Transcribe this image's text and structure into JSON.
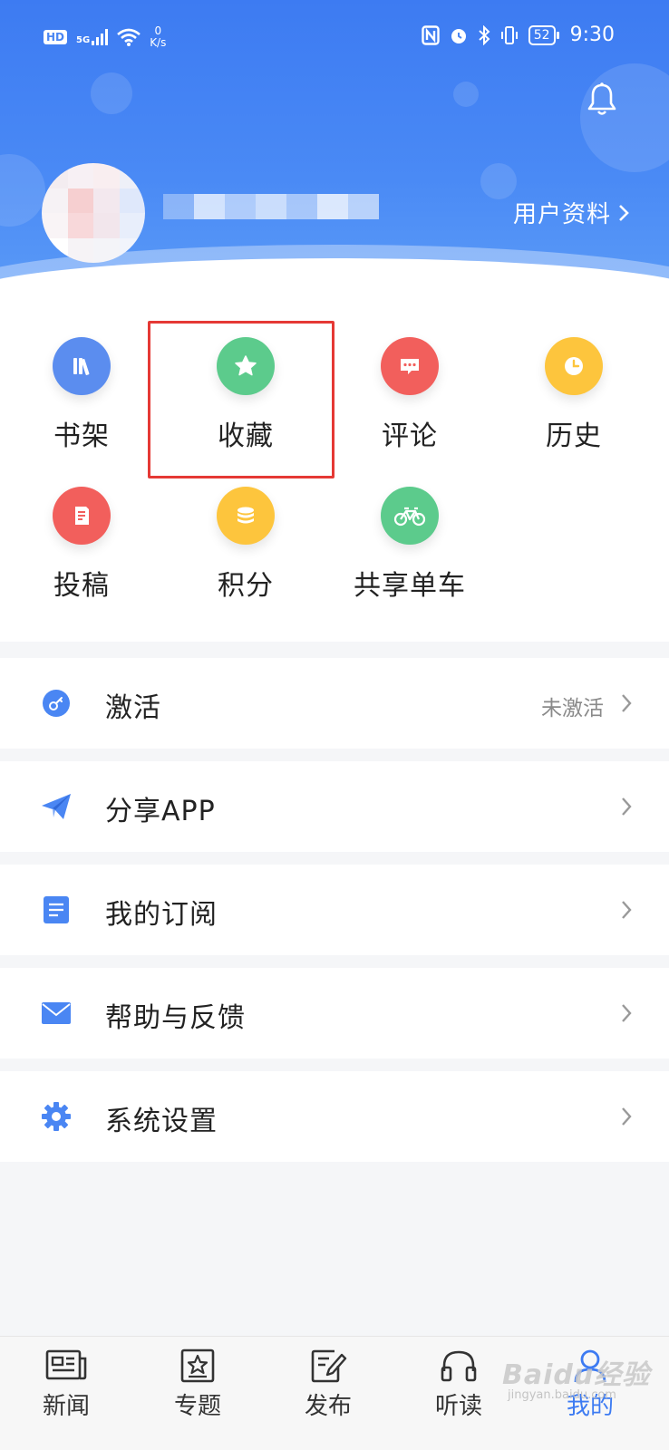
{
  "status_bar": {
    "hd": "HD",
    "network": "5G",
    "speed_value": "0",
    "speed_unit": "K/s",
    "battery": "52",
    "time": "9:30"
  },
  "profile": {
    "link_label": "用户资料",
    "link_icon": "chevron-right-icon"
  },
  "grid": [
    {
      "label": "书架",
      "icon": "bookshelf-icon",
      "color": "#5b8def"
    },
    {
      "label": "收藏",
      "icon": "star-icon",
      "color": "#5ccb8c"
    },
    {
      "label": "评论",
      "icon": "comment-icon",
      "color": "#f25f5c"
    },
    {
      "label": "历史",
      "icon": "clock-icon",
      "color": "#fdc53d"
    },
    {
      "label": "投稿",
      "icon": "document-icon",
      "color": "#f25f5c"
    },
    {
      "label": "积分",
      "icon": "coins-icon",
      "color": "#fdc53d"
    },
    {
      "label": "共享单车",
      "icon": "bicycle-icon",
      "color": "#5ccb8c"
    }
  ],
  "menu": [
    {
      "label": "激活",
      "value": "未激活",
      "icon": "key-icon"
    },
    {
      "label": "分享APP",
      "value": "",
      "icon": "paper-plane-icon"
    },
    {
      "label": "我的订阅",
      "value": "",
      "icon": "subscription-icon"
    },
    {
      "label": "帮助与反馈",
      "value": "",
      "icon": "mail-icon"
    },
    {
      "label": "系统设置",
      "value": "",
      "icon": "gear-icon"
    }
  ],
  "tabs": [
    {
      "label": "新闻",
      "icon": "newspaper-icon"
    },
    {
      "label": "专题",
      "icon": "topic-star-icon"
    },
    {
      "label": "发布",
      "icon": "edit-icon"
    },
    {
      "label": "听读",
      "icon": "headphones-icon"
    },
    {
      "label": "我的",
      "icon": "user-icon"
    }
  ],
  "watermark": {
    "text": "Baidu经验",
    "sub": "jingyan.baidu.com"
  },
  "colors": {
    "brand": "#3d7bf2",
    "highlight": "#e53935"
  }
}
